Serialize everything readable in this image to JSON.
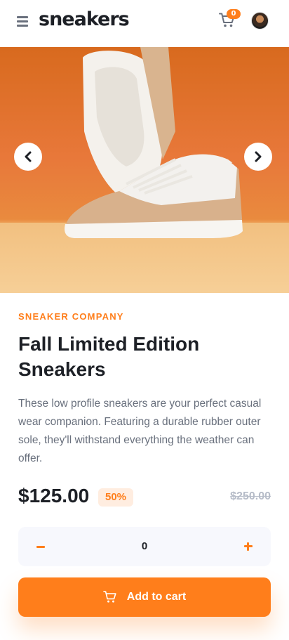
{
  "header": {
    "logo": "sneakers",
    "cart_count": "0",
    "menu_icon": "hamburger-icon",
    "cart_icon": "cart-icon"
  },
  "gallery": {
    "prev_icon": "chevron-left-icon",
    "next_icon": "chevron-right-icon"
  },
  "product": {
    "company": "SNEAKER COMPANY",
    "title": "Fall Limited Edition Sneakers",
    "description": "These low profile sneakers are your perfect casual wear companion. Featuring a durable rubber outer sole, they'll withstand everything the weather can offer.",
    "price": "$125.00",
    "discount": "50%",
    "original_price": "$250.00"
  },
  "quantity": {
    "value": "0",
    "minus_icon": "minus-icon",
    "plus_icon": "plus-icon"
  },
  "actions": {
    "add_to_cart": "Add to cart"
  },
  "colors": {
    "accent": "#ff7e1b",
    "accent_pale": "#ffede0",
    "text_dark": "#1d2026",
    "text_gray": "#69707d",
    "text_light": "#b6bcc8"
  }
}
